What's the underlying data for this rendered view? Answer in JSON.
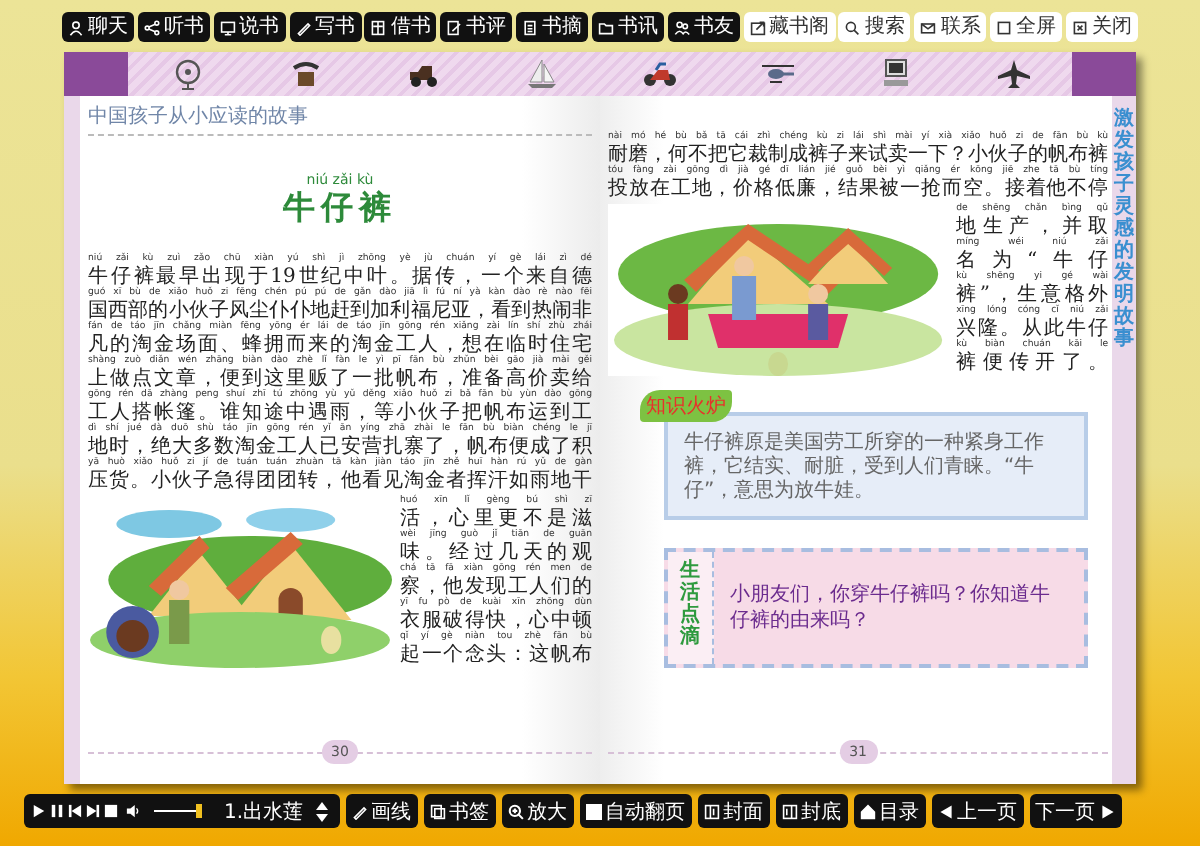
{
  "toolbar": {
    "buttons": [
      {
        "label": "聊天",
        "kind": "dark"
      },
      {
        "label": "听书",
        "kind": "dark"
      },
      {
        "label": "说书",
        "kind": "dark"
      },
      {
        "label": "写书",
        "kind": "dark"
      },
      {
        "label": "借书",
        "kind": "dark"
      },
      {
        "label": "书评",
        "kind": "dark"
      },
      {
        "label": "书摘",
        "kind": "dark"
      },
      {
        "label": "书讯",
        "kind": "dark"
      },
      {
        "label": "书友",
        "kind": "dark"
      },
      {
        "label": "藏书阁",
        "kind": "light"
      },
      {
        "label": "搜索",
        "kind": "light"
      },
      {
        "label": "联系",
        "kind": "light"
      },
      {
        "label": "全屏",
        "kind": "light"
      },
      {
        "label": "关闭",
        "kind": "light"
      }
    ]
  },
  "left_page": {
    "header": "中国孩子从小应读的故事",
    "title_pinyin": "niú zǎi kù",
    "title": "牛仔裤",
    "lines": [
      {
        "pinyin": "niú zǎi kù zuì zǎo chū xiàn yú shì jì zhōng yè jù chuán yí gè lái zì dé",
        "text": "牛仔裤最早出现于19世纪中叶。据传，一个来自德"
      },
      {
        "pinyin": "guó xī bù de xiǎo huǒ zi fēng chén pú pú de gǎn dào jiā lì fú ní yà kàn dào rè nào fēi",
        "text": "国西部的小伙子风尘仆仆地赶到加利福尼亚，看到热闹非"
      },
      {
        "pinyin": "fán de táo jīn chǎng miàn fēng yōng ér lái de táo jīn gōng rén xiǎng zài lín shí zhù zhái",
        "text": "凡的淘金场面、蜂拥而来的淘金工人，想在临时住宅"
      },
      {
        "pinyin": "shàng zuò diǎn wén zhāng biàn dào zhè lǐ fàn le yì pī fān bù zhǔn bèi gāo jià mài gěi",
        "text": "上做点文章，便到这里贩了一批帆布，准备高价卖给"
      },
      {
        "pinyin": "gōng rén dā zhàng peng shuí zhī tú zhōng yù yǔ děng xiǎo huǒ zi bǎ fān bù yùn dào gōng",
        "text": "工人搭帐篷。谁知途中遇雨，等小伙子把帆布运到工"
      },
      {
        "pinyin": "dì shí jué dà duō shù táo jīn gōng rén yǐ ān yíng zhā zhài le fān bù biàn chéng le jī",
        "text": "地时，绝大多数淘金工人已安营扎寨了，帆布便成了积"
      },
      {
        "pinyin": "yā huò xiǎo huǒ zi jí de tuán tuán zhuàn tā kàn jiàn táo jīn zhě huī hàn rú yǔ de gàn",
        "text": "压货。小伙子急得团团转，他看见淘金者挥汗如雨地干"
      }
    ],
    "side_lines": [
      {
        "pinyin": "huó xīn lǐ gèng bú shì zī",
        "text": "活，心里更不是滋"
      },
      {
        "pinyin": "wèi jīng guò jǐ tiān de guān",
        "text": "味。经过几天的观"
      },
      {
        "pinyin": "chá tā fā xiàn gōng rén men de",
        "text": "察，他发现工人们的"
      },
      {
        "pinyin": "yī fu pò de kuài xīn zhōng dùn",
        "text": "衣服破得快，心中顿"
      },
      {
        "pinyin": "qǐ yí gè niàn tou zhè fān bù",
        "text": "起一个念头：这帆布"
      }
    ],
    "page_number": "30"
  },
  "right_page": {
    "lines": [
      {
        "pinyin": "nài mó hé bù bǎ tā cái zhì chéng kù zi lái shì mài yí xià xiǎo huǒ zi de fān bù kù",
        "text": "耐磨，何不把它裁制成裤子来试卖一下？小伙子的帆布裤"
      },
      {
        "pinyin": "tóu fàng zài gōng dì jià gé dī lián jié guǒ bèi yì qiǎng ér kōng jiē zhe tā bù tíng",
        "text": "投放在工地，价格低廉，结果被一抢而空。接着他不停"
      }
    ],
    "side_lines": [
      {
        "pinyin": "de shēng chǎn bìng qǔ",
        "text": "地生产，并取"
      },
      {
        "pinyin": "míng wéi niú zǎi",
        "text": "名为“牛仔"
      },
      {
        "pinyin": "kù shēng yi gé wài",
        "text": "裤”，生意格外"
      },
      {
        "pinyin": "xīng lóng cóng cǐ niú zǎi",
        "text": "兴隆。从此牛仔"
      },
      {
        "pinyin": "kù biàn chuán kāi le",
        "text": "裤便传开了。"
      }
    ],
    "tab": "激发孩子灵感的发明故事",
    "knowledge": {
      "label": "知识火炉",
      "text": "牛仔裤原是美国劳工所穿的一种紧身工作裤，它结实、耐脏，受到人们青睐。“牛仔”，意思为放牛娃。"
    },
    "life_tip": {
      "label": "生活点滴",
      "text": "小朋友们，你穿牛仔裤吗？你知道牛仔裤的由来吗？"
    },
    "page_number": "31"
  },
  "player": {
    "level": 0.92,
    "track": "1.出水莲"
  },
  "nav_buttons": [
    {
      "label": "画线"
    },
    {
      "label": "书签"
    },
    {
      "label": "放大"
    },
    {
      "label": "自动翻页"
    },
    {
      "label": "封面"
    },
    {
      "label": "封底"
    },
    {
      "label": "目录"
    },
    {
      "label": "上一页"
    },
    {
      "label": "下一页"
    }
  ]
}
